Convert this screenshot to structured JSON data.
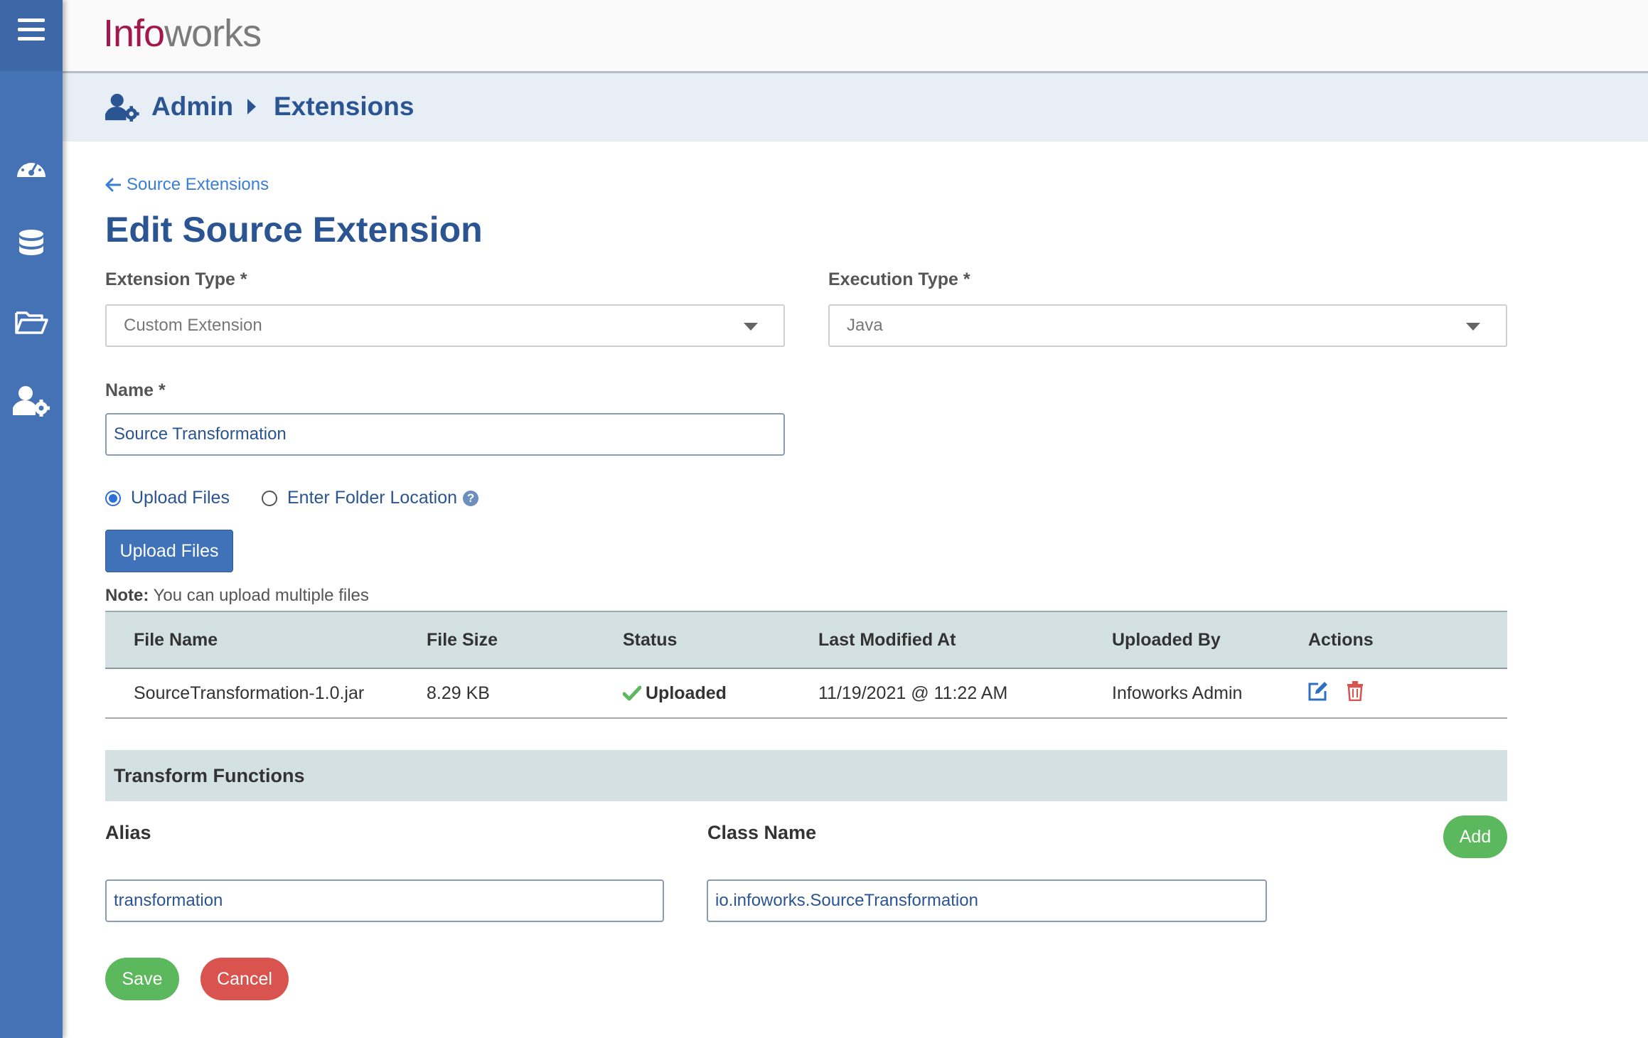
{
  "app": {
    "logo_part1": "Info",
    "logo_part2": "works"
  },
  "sidebar": {
    "items": [
      {
        "icon": "menu-icon"
      },
      {
        "icon": "dashboard-icon"
      },
      {
        "icon": "database-icon"
      },
      {
        "icon": "folder-icon"
      },
      {
        "icon": "admin-settings-icon"
      }
    ]
  },
  "breadcrumb": {
    "root": "Admin",
    "current": "Extensions"
  },
  "page": {
    "back_link": "Source Extensions",
    "title": "Edit Source Extension"
  },
  "form": {
    "extension_type_label": "Extension Type *",
    "extension_type_value": "Custom Extension",
    "execution_type_label": "Execution Type *",
    "execution_type_value": "Java",
    "name_label": "Name *",
    "name_value": "Source Transformation",
    "radio_upload": "Upload Files",
    "radio_folder": "Enter Folder Location",
    "selected_mode": "Upload Files",
    "upload_button": "Upload Files",
    "note_label": "Note:",
    "note_text": " You can upload multiple files"
  },
  "files_table": {
    "headers": [
      "File Name",
      "File Size",
      "Status",
      "Last Modified At",
      "Uploaded By",
      "Actions"
    ],
    "rows": [
      {
        "file_name": "SourceTransformation-1.0.jar",
        "file_size": "8.29 KB",
        "status": "Uploaded",
        "last_modified": "11/19/2021 @ 11:22 AM",
        "uploaded_by": "Infoworks Admin"
      }
    ]
  },
  "transform_functions": {
    "section_title": "Transform Functions",
    "alias_label": "Alias",
    "class_name_label": "Class Name",
    "add_button": "Add",
    "alias_value": "transformation",
    "class_name_value": "io.infoworks.SourceTransformation"
  },
  "actions": {
    "save": "Save",
    "cancel": "Cancel"
  },
  "colors": {
    "sidebar": "#4472b4",
    "brand": "#a3184a",
    "heading": "#2a5492",
    "success": "#5cb85c",
    "danger": "#d9534f"
  }
}
